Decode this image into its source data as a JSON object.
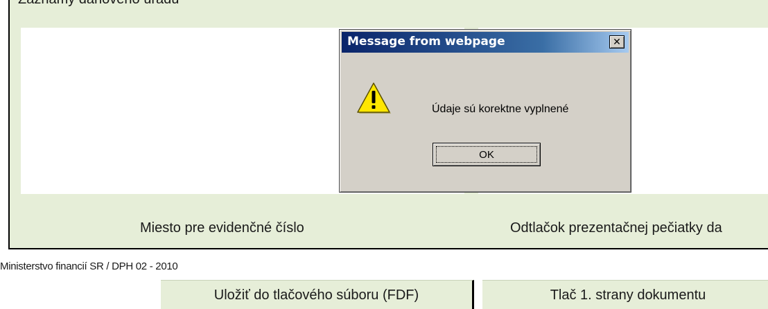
{
  "form": {
    "section_title": "Záznamy daňového úradu",
    "label_left": "Miesto pre evidenčné číslo",
    "label_right": "Odtlačok prezentačnej pečiatky da"
  },
  "footer": {
    "text": "Ministerstvo financií SR / DPH 02 - 2010"
  },
  "buttons": {
    "save_fdf": "Uložiť do tlačového súboru (FDF)",
    "print_first_page": "Tlač 1. strany dokumentu"
  },
  "dialog": {
    "title": "Message from webpage",
    "close_glyph": "✕",
    "message": "Údaje sú korektne vyplnené",
    "ok_label": "OK",
    "icon": "warning-icon"
  },
  "colors": {
    "form_background": "#e6eed8",
    "dialog_background": "#d4d0c8",
    "titlebar_start": "#0a246a",
    "titlebar_end": "#a6caf0",
    "warning_yellow": "#ffe600"
  }
}
